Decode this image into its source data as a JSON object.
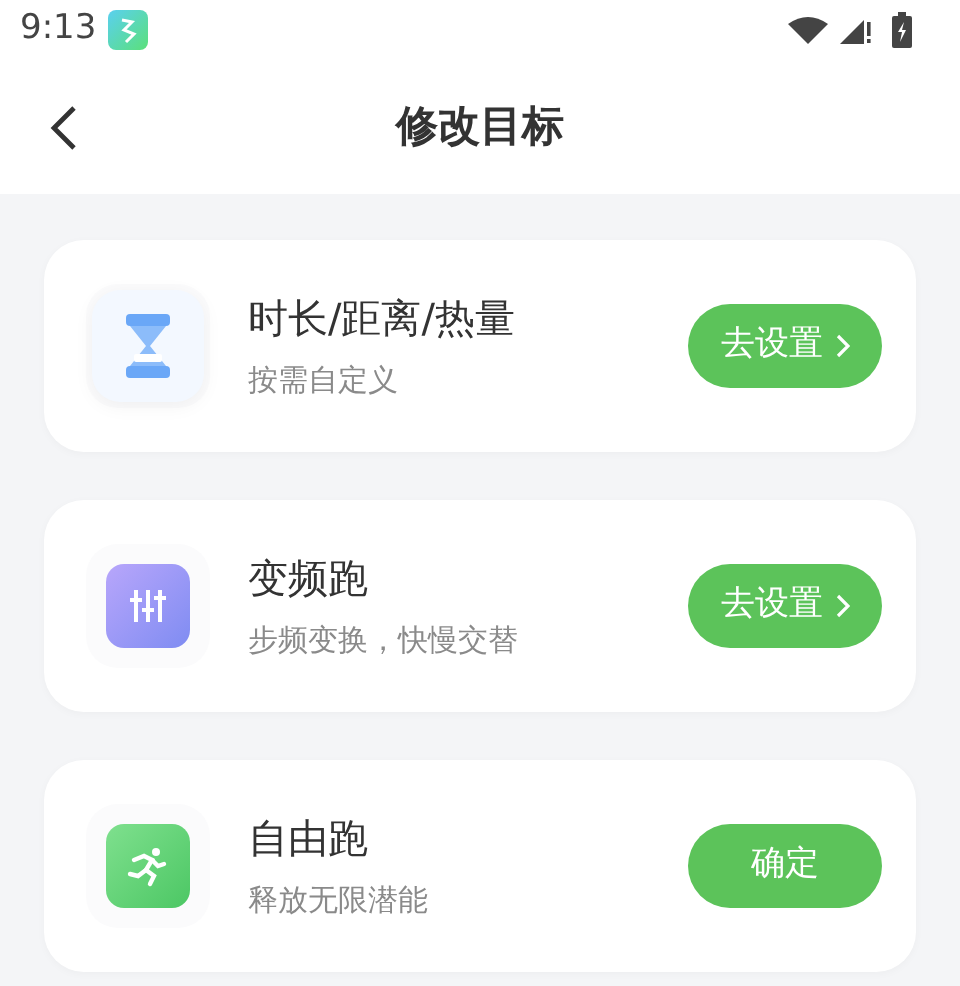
{
  "status_bar": {
    "time": "9:13"
  },
  "header": {
    "title": "修改目标"
  },
  "goals": [
    {
      "kind": "hourglass",
      "title": "时长/距离/热量",
      "subtitle": "按需自定义",
      "button": "去设置",
      "arrow": true
    },
    {
      "kind": "sliders",
      "title": "变频跑",
      "subtitle": "步频变换，快慢交替",
      "button": "去设置",
      "arrow": true
    },
    {
      "kind": "runner",
      "title": "自由跑",
      "subtitle": "释放无限潜能",
      "button": "确定",
      "arrow": false
    }
  ]
}
